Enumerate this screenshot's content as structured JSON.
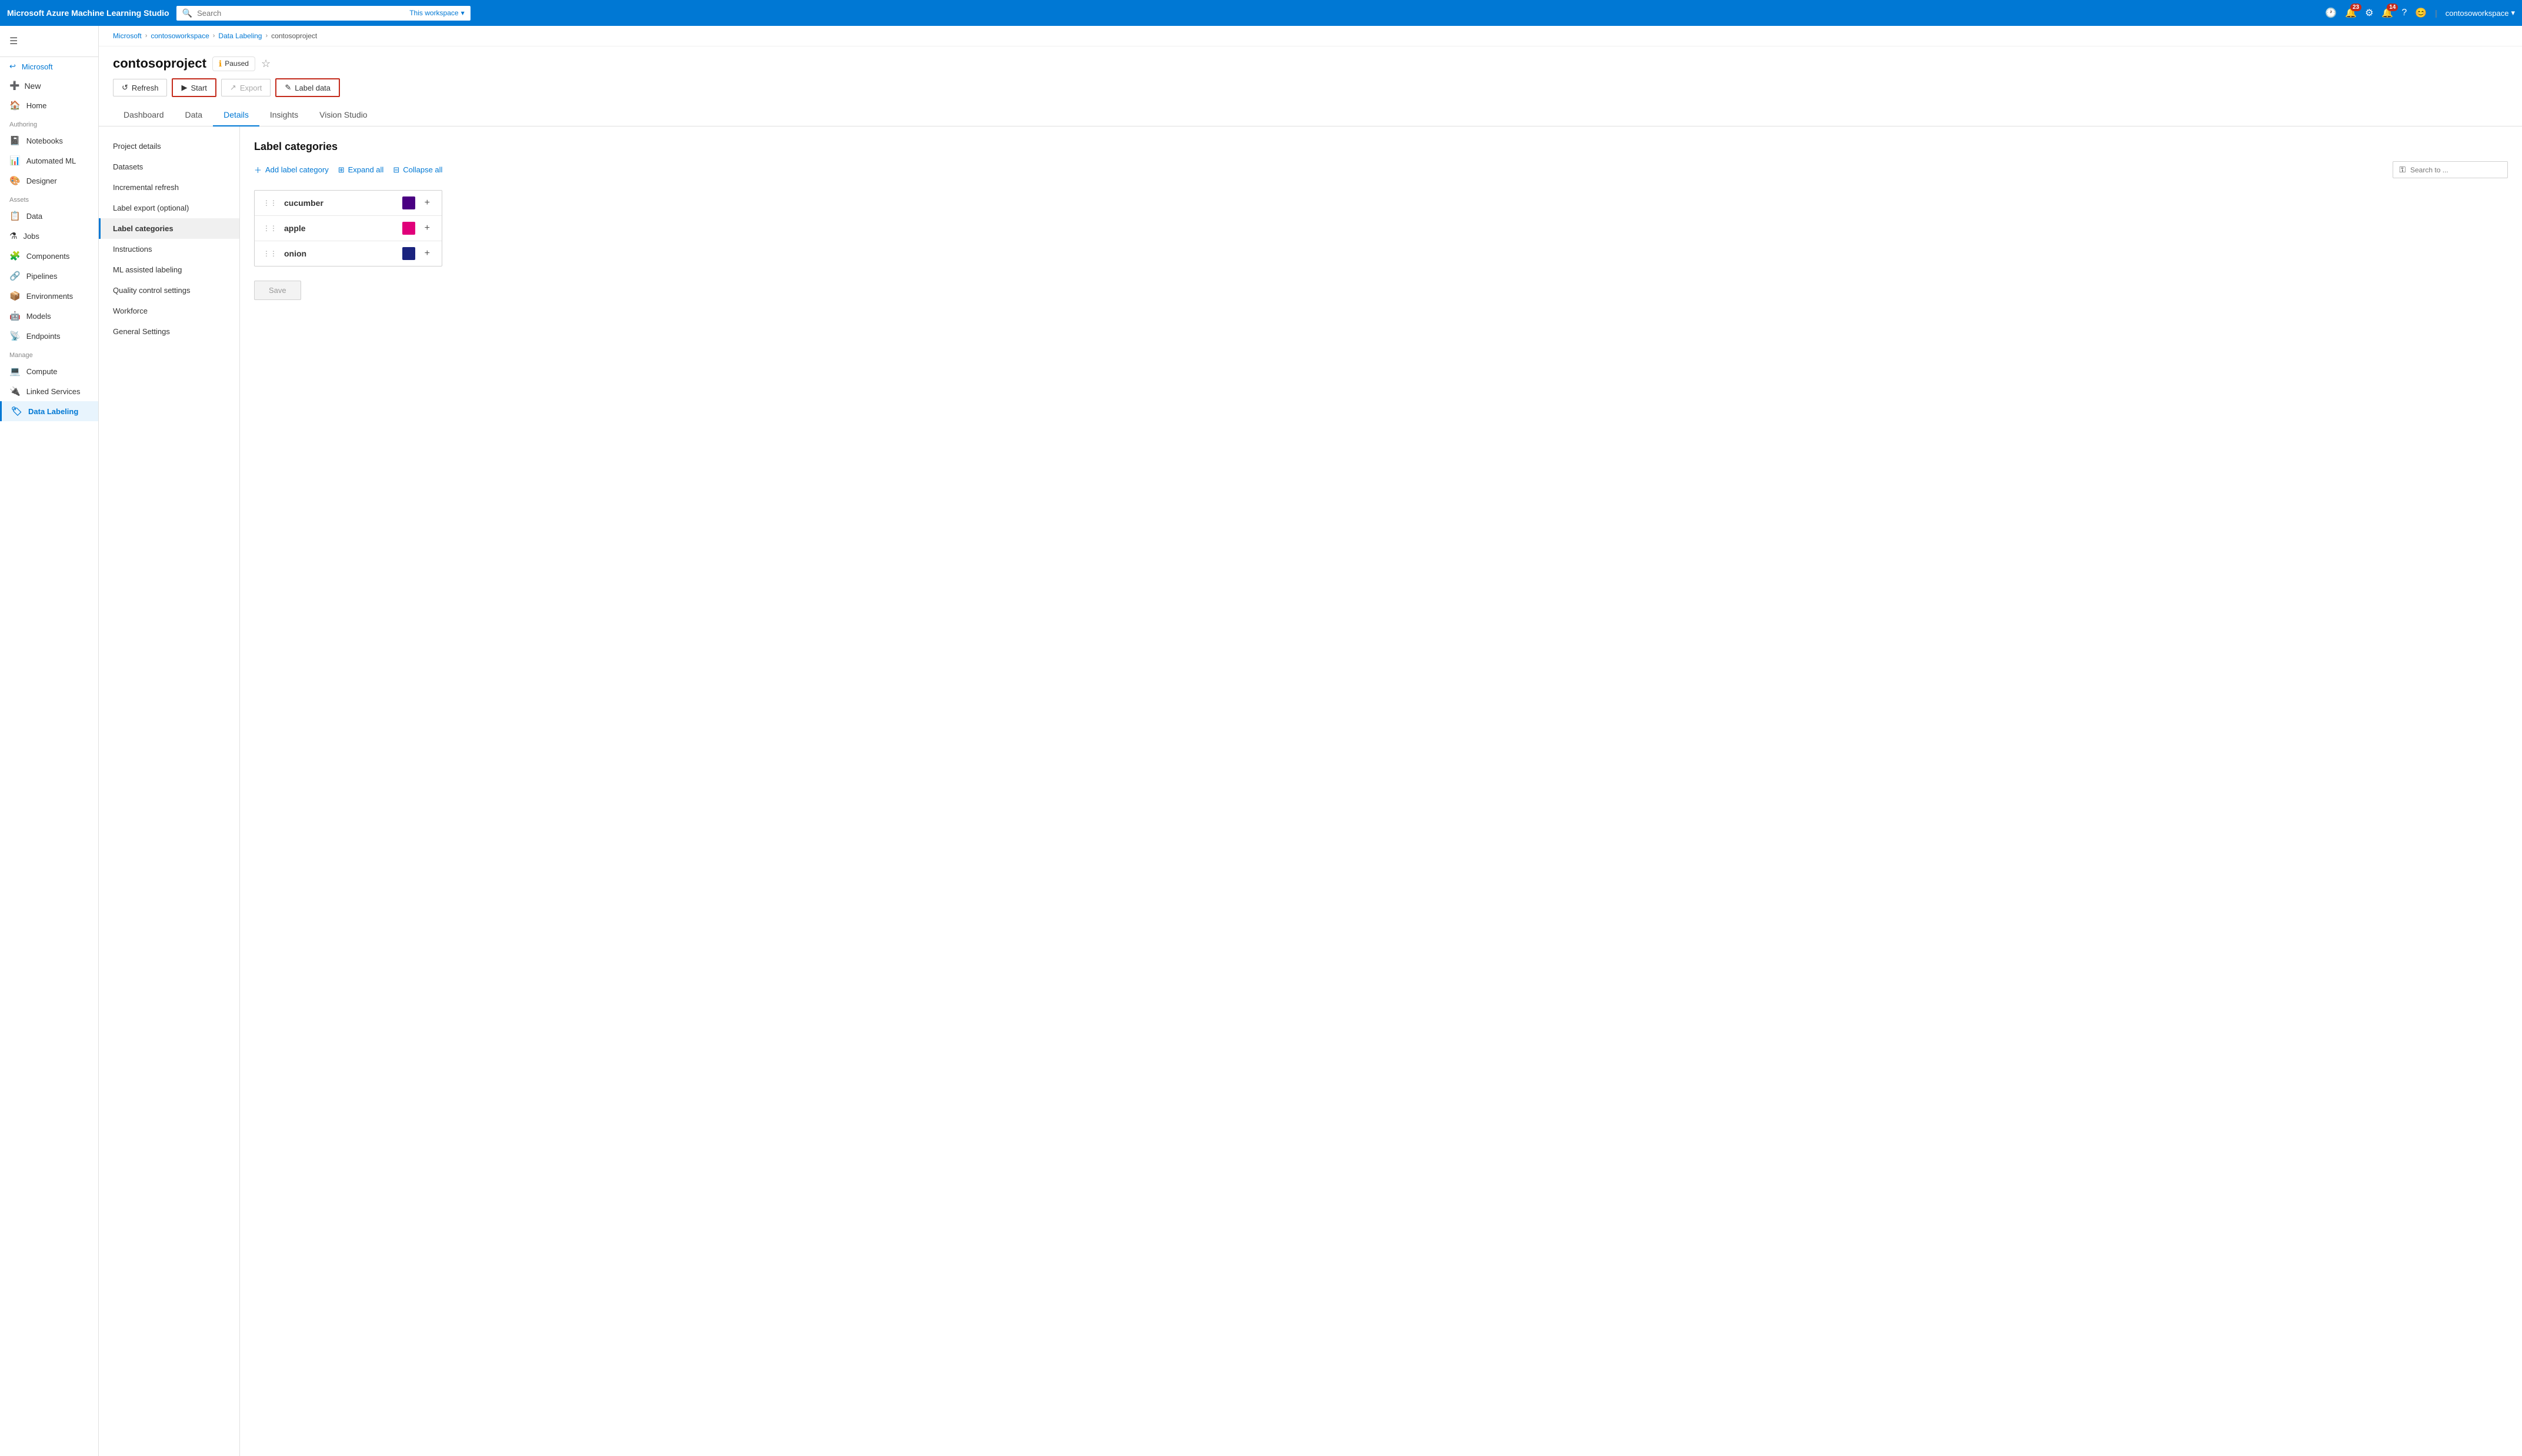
{
  "topNav": {
    "brand": "Microsoft Azure Machine Learning Studio",
    "searchPlaceholder": "Search",
    "searchScope": "This workspace",
    "notificationCount1": "23",
    "notificationCount2": "14",
    "username": "contosoworkspace"
  },
  "sidebar": {
    "microsoftLabel": "Microsoft",
    "newLabel": "New",
    "homeLabel": "Home",
    "authoringLabel": "Authoring",
    "notebooksLabel": "Notebooks",
    "automatedMLLabel": "Automated ML",
    "designerLabel": "Designer",
    "assetsLabel": "Assets",
    "dataLabel": "Data",
    "jobsLabel": "Jobs",
    "componentsLabel": "Components",
    "pipelinesLabel": "Pipelines",
    "environmentsLabel": "Environments",
    "modelsLabel": "Models",
    "endpointsLabel": "Endpoints",
    "manageLabel": "Manage",
    "computeLabel": "Compute",
    "linkedServicesLabel": "Linked Services",
    "dataLabelingLabel": "Data Labeling"
  },
  "breadcrumb": {
    "microsoft": "Microsoft",
    "contosoworkspace": "contosoworkspace",
    "dataLabeling": "Data Labeling",
    "contosoproject": "contosoproject"
  },
  "pageHeader": {
    "title": "contosoproject",
    "statusLabel": "Paused",
    "refreshLabel": "Refresh",
    "startLabel": "Start",
    "exportLabel": "Export",
    "labelDataLabel": "Label data"
  },
  "tabs": [
    {
      "id": "dashboard",
      "label": "Dashboard"
    },
    {
      "id": "data",
      "label": "Data"
    },
    {
      "id": "details",
      "label": "Details"
    },
    {
      "id": "insights",
      "label": "Insights"
    },
    {
      "id": "visionStudio",
      "label": "Vision Studio"
    }
  ],
  "leftNav": [
    {
      "id": "projectDetails",
      "label": "Project details"
    },
    {
      "id": "datasets",
      "label": "Datasets"
    },
    {
      "id": "incrementalRefresh",
      "label": "Incremental refresh"
    },
    {
      "id": "labelExport",
      "label": "Label export (optional)"
    },
    {
      "id": "labelCategories",
      "label": "Label categories"
    },
    {
      "id": "instructions",
      "label": "Instructions"
    },
    {
      "id": "mlAssistedLabeling",
      "label": "ML assisted labeling"
    },
    {
      "id": "qualityControl",
      "label": "Quality control settings"
    },
    {
      "id": "workforce",
      "label": "Workforce"
    },
    {
      "id": "generalSettings",
      "label": "General Settings"
    }
  ],
  "labelCategories": {
    "sectionTitle": "Label categories",
    "addLabel": "Add label category",
    "expandAll": "Expand all",
    "collapseAll": "Collapse all",
    "searchPlaceholder": "Search to ...",
    "categories": [
      {
        "name": "cucumber",
        "color": "#4a0082"
      },
      {
        "name": "apple",
        "color": "#e0007a"
      },
      {
        "name": "onion",
        "color": "#1a237e"
      }
    ]
  },
  "saveLabel": "Save"
}
